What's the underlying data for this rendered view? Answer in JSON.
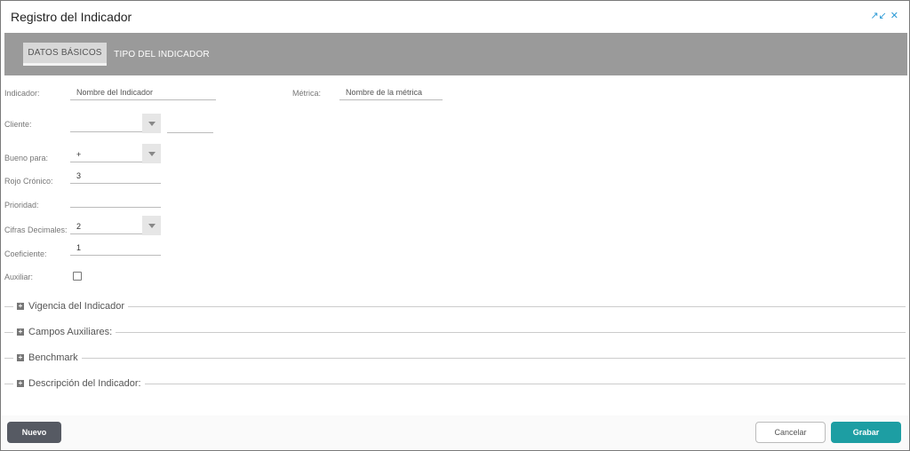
{
  "dialog": {
    "title": "Registro del Indicador",
    "icons": [
      "collapse-icon",
      "close-icon"
    ]
  },
  "tabs": [
    {
      "label": "DATOS BÁSICOS",
      "active": true
    },
    {
      "label": "TIPO DEL INDICADOR",
      "active": false
    }
  ],
  "form": {
    "indicador": {
      "label": "Indicador:",
      "placeholder": "Nombre del Indicador"
    },
    "metrica": {
      "label": "Métrica:",
      "placeholder": "Nombre de la métrica"
    },
    "cliente": {
      "label": "Cliente:",
      "value": ""
    },
    "bueno_para": {
      "label": "Bueno para:",
      "value": "+"
    },
    "rojo_cronico": {
      "label": "Rojo Crónico:",
      "value": "3"
    },
    "prioridad": {
      "label": "Prioridad:",
      "value": ""
    },
    "cifras_decimales": {
      "label": "Cifras Decimales:",
      "value": "2"
    },
    "coeficiente": {
      "label": "Coeficiente:",
      "value": "1"
    },
    "auxiliar": {
      "label": "Auxiliar:",
      "checked": false
    }
  },
  "sections": [
    {
      "title": "Vigencia del Indicador"
    },
    {
      "title": "Campos Auxiliares:"
    },
    {
      "title": "Benchmark"
    },
    {
      "title": "Descripción del Indicador:"
    }
  ],
  "footer": {
    "nuevo": "Nuevo",
    "cancelar": "Cancelar",
    "grabar": "Grabar"
  },
  "colors": {
    "accent": "#1d9ea3",
    "tabbar": "#9a9a9a",
    "nuevo": "#565a63",
    "icon": "#2e9bd6"
  }
}
